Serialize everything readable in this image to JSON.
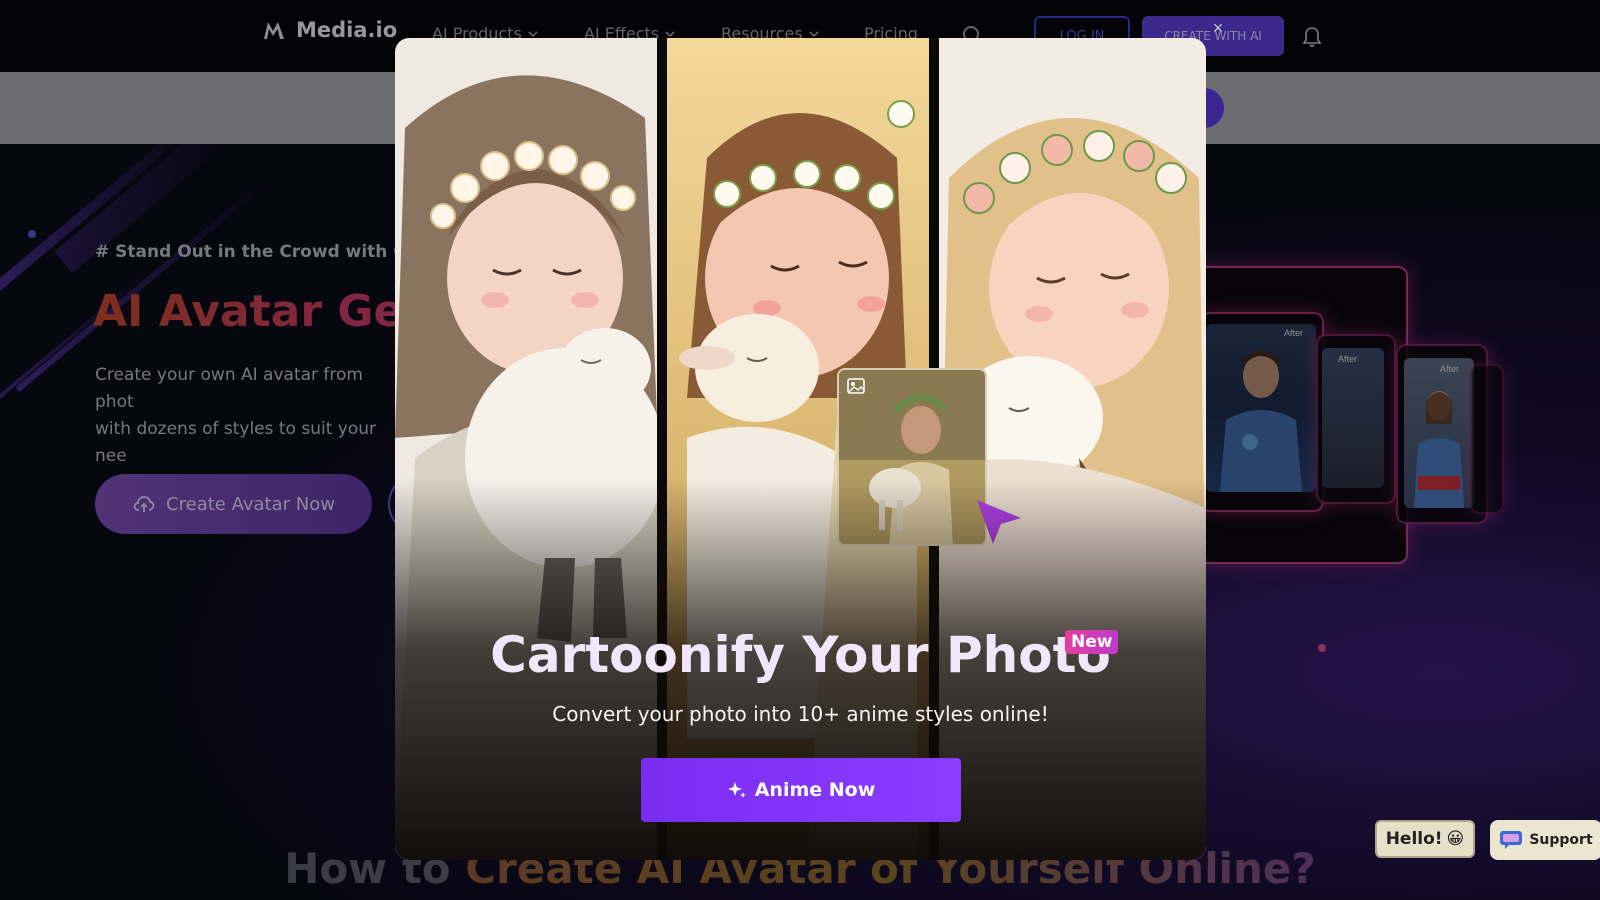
{
  "nav": {
    "brand": "Media.io",
    "items": [
      {
        "label": "AI Products",
        "has_dropdown": true
      },
      {
        "label": "AI Effects",
        "has_dropdown": true
      },
      {
        "label": "Resources",
        "has_dropdown": true
      },
      {
        "label": "Pricing",
        "has_dropdown": false
      }
    ],
    "login_label": "LOG IN",
    "create_label": "CREATE WITH AI",
    "icons": [
      "logo-icon",
      "chevron-down-icon",
      "search-icon",
      "bell-icon"
    ]
  },
  "hero": {
    "kicker": "# Stand Out in the Crowd with Our",
    "title": "AI Avatar Ger",
    "description_line1": "Create your own AI avatar from phot",
    "description_line2": "with dozens of styles to suit your nee",
    "cta_label": "Create Avatar Now",
    "cta_icon": "cloud-upload-icon",
    "preview_tags": [
      "After",
      "After",
      "After"
    ]
  },
  "section": {
    "heading_part1": "How to ",
    "heading_part2": "Create AI Avatar of Yourself Online?"
  },
  "modal": {
    "title": "Cartoonify Your Photo",
    "badge": "New",
    "subtitle": "Convert your photo into 10+ anime styles online!",
    "cta_label": "Anime Now",
    "cta_icon": "sparkle-icon",
    "close_label": "×"
  },
  "widgets": {
    "hello_label": "Hello!",
    "hello_emoji": "😀",
    "support_label": "Support"
  },
  "colors": {
    "nav_bg": "#050508",
    "accent_purple": "#7a2cf0",
    "hero_title_start": "#c2472b",
    "hero_title_end": "#c93a6b",
    "preview_border": "#c23a8e",
    "badge_pink": "#e0409a"
  }
}
